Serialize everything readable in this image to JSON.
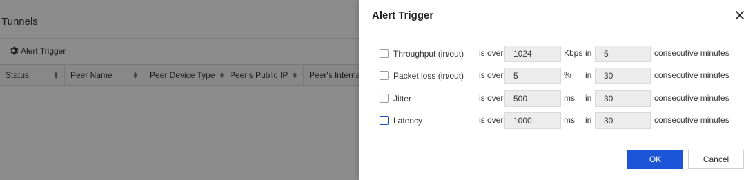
{
  "background": {
    "title": "Tunnels",
    "toolbar": {
      "alert_trigger_label": "Alert Trigger"
    },
    "table": {
      "columns": [
        "Status",
        "Peer Name",
        "Peer Device Type",
        "Peer's Public IP",
        "Peer's Internal"
      ]
    }
  },
  "modal": {
    "title": "Alert Trigger",
    "rows": [
      {
        "label": "Throughput (in/out)",
        "is_over": "is over",
        "value": "1024",
        "unit": "Kbps",
        "in": "in",
        "minutes": "5",
        "suffix": "consecutive minutes"
      },
      {
        "label": "Packet loss (in/out)",
        "is_over": "is over",
        "value": "5",
        "unit": "%",
        "in": "in",
        "minutes": "30",
        "suffix": "consecutive minutes"
      },
      {
        "label": "Jitter",
        "is_over": "is over",
        "value": "500",
        "unit": "ms",
        "in": "in",
        "minutes": "30",
        "suffix": "consecutive minutes"
      },
      {
        "label": "Latency",
        "is_over": "is over",
        "value": "1000",
        "unit": "ms",
        "in": "in",
        "minutes": "30",
        "suffix": "consecutive minutes"
      }
    ],
    "ok_label": "OK",
    "cancel_label": "Cancel"
  },
  "colors": {
    "primary": "#1d55d8",
    "overlay": "rgba(0,0,0,0.45)",
    "input_bg": "#ececec"
  }
}
